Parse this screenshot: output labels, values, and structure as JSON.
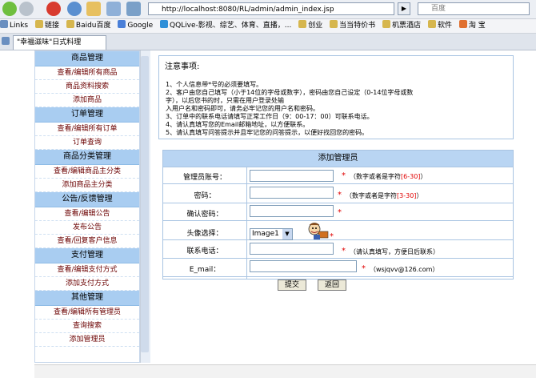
{
  "browser": {
    "address": "http://localhost:8080/RL/admin/admin_index.jsp",
    "search_placeholder": "百度",
    "bookmarks": [
      "Links",
      "链接",
      "Baidu百度",
      "Google",
      "QQLive-影视、综艺、体育、直播，...",
      "创业",
      "当当特价书",
      "机票酒店",
      "软件",
      "淘 宝"
    ],
    "tab_title": "\"幸福滋味\"日式料理"
  },
  "sidebar": {
    "sections": [
      {
        "title": "商品管理",
        "items": [
          "查看/编辑所有商品",
          "商品资料搜索",
          "添加商品"
        ]
      },
      {
        "title": "订单管理",
        "items": [
          "查看/编辑所有订单",
          "订单查询"
        ]
      },
      {
        "title": "商品分类管理",
        "items": [
          "查看/编辑商品主分类",
          "添加商品主分类"
        ]
      },
      {
        "title": "公告/反馈管理",
        "items": [
          "查看/编辑公告",
          "发布公告",
          "查看/回复客户信息"
        ]
      },
      {
        "title": "支付管理",
        "items": [
          "查看/编辑支付方式",
          "添加支付方式"
        ]
      },
      {
        "title": "其他管理",
        "items": [
          "查看/编辑所有管理员",
          "查询搜索",
          "添加管理员"
        ]
      }
    ]
  },
  "notice": {
    "title": "注意事项:",
    "lines": [
      "1、个人信息带*号的必须要填写。",
      "2、客户由您自己填写（小于14位的字母或数字），密码由您自己设定（0-14位字母或数",
      "字），以后您书的时，只需在用户登录处输",
      "入用户名和密码即可，请务必牢记您的用户名和密码。",
      "3、订单中的联系电话请填写正常工作日（9：00-17：00）可联系电话。",
      "4、请认真填写您的Email邮箱地址，以方便联系。",
      "5、请认真填写问答提示并且牢记您的问答提示，以便好找回您的密码。"
    ]
  },
  "form": {
    "title": "添加管理员",
    "fields": {
      "account": {
        "label": "管理员账号：",
        "value": "",
        "hint_pre": "（数字或者是字符",
        "hint_red": "[6-30]",
        "hint_post": "）"
      },
      "password": {
        "label": "密码：",
        "value": "",
        "hint_pre": "（数字或者是字符",
        "hint_red": "[3-30]",
        "hint_post": "）"
      },
      "confirm": {
        "label": "确认密码：",
        "value": ""
      },
      "avatar": {
        "label": "头像选择：",
        "selected": "Image1"
      },
      "phone": {
        "label": "联系电话：",
        "value": "",
        "hint": "（请认真填写，方便日后联系）"
      },
      "email": {
        "label": "E_mail：",
        "value": "",
        "hint": "（wsjqvv@126.com）"
      }
    },
    "submit": "提交",
    "back": "返回",
    "star": "*"
  },
  "colors": {
    "header_blue": "#a9cdf1",
    "link_maroon": "#6b0000",
    "required_red": "#e00000"
  }
}
